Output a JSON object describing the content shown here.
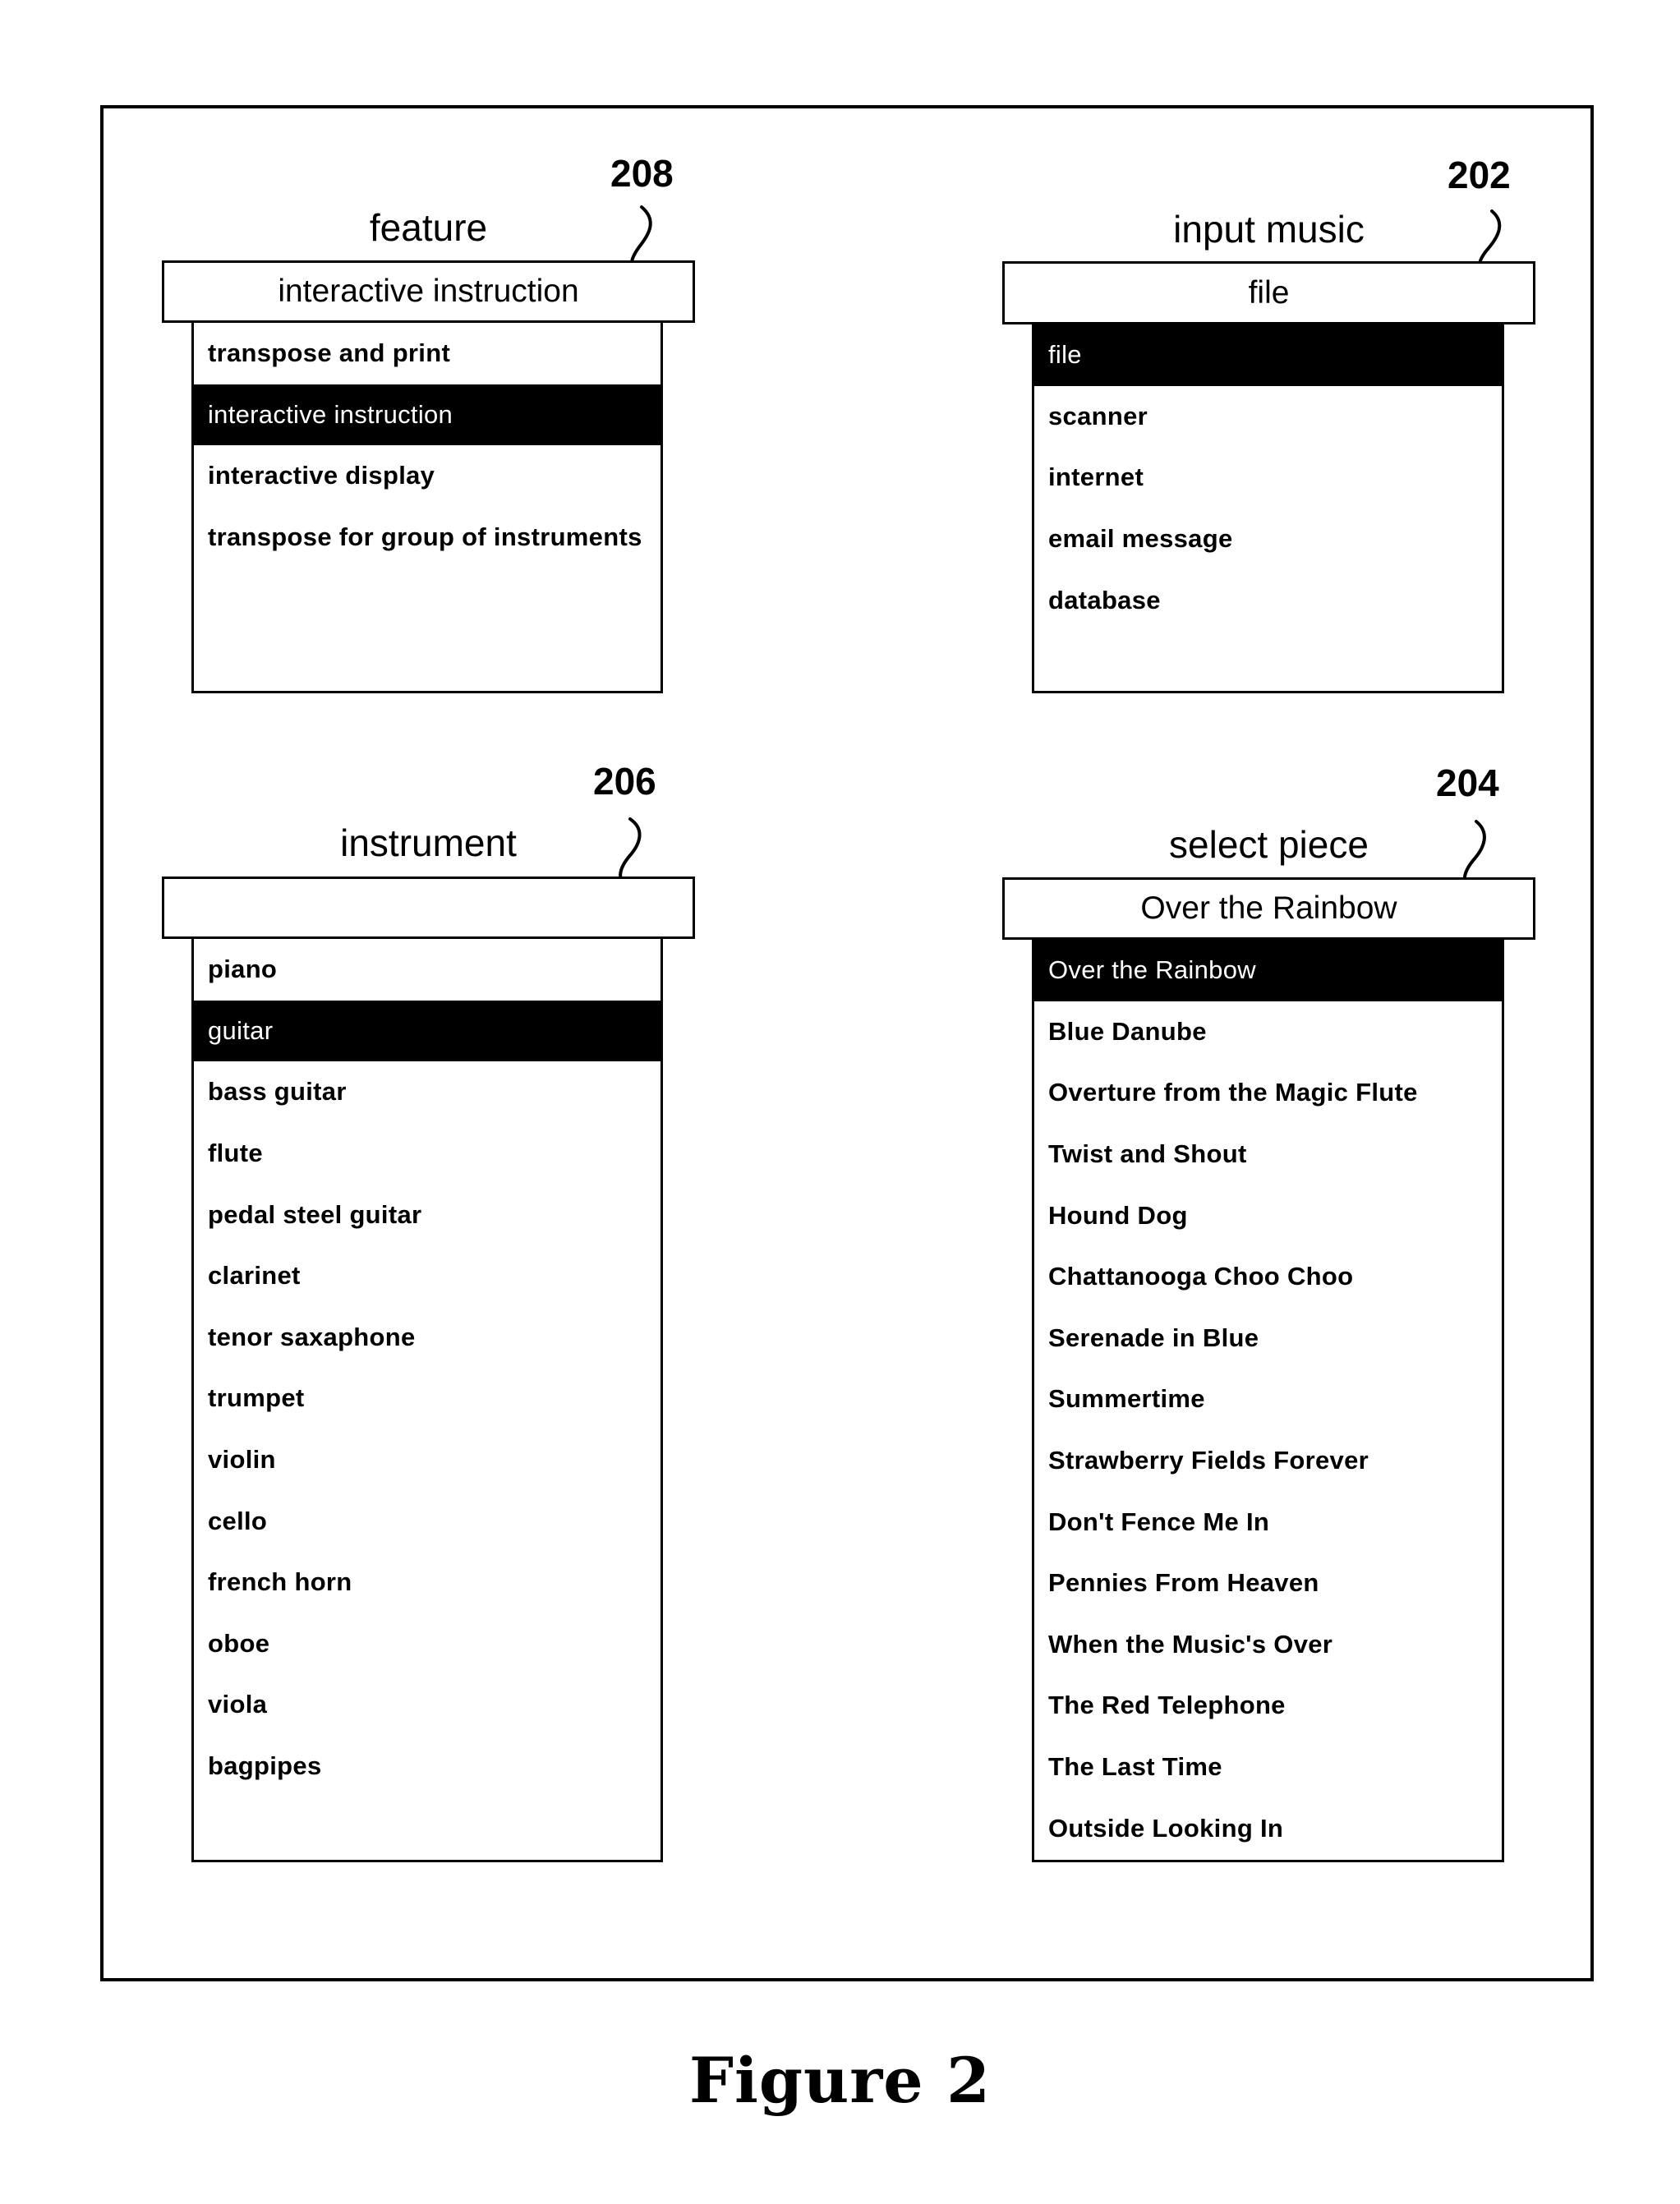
{
  "figure": {
    "caption": "Figure 2"
  },
  "panels": {
    "feature": {
      "ref_number": "208",
      "label": "feature",
      "combo_value": "interactive instruction",
      "items": [
        {
          "label": "transpose and print",
          "selected": false
        },
        {
          "label": "interactive instruction",
          "selected": true
        },
        {
          "label": "interactive display",
          "selected": false
        },
        {
          "label": "transpose for group of instruments",
          "selected": false
        }
      ]
    },
    "input_music": {
      "ref_number": "202",
      "label": "input music",
      "combo_value": "file",
      "items": [
        {
          "label": "file",
          "selected": true
        },
        {
          "label": "scanner",
          "selected": false
        },
        {
          "label": "internet",
          "selected": false
        },
        {
          "label": "email message",
          "selected": false
        },
        {
          "label": "database",
          "selected": false
        }
      ]
    },
    "instrument": {
      "ref_number": "206",
      "label": "instrument",
      "combo_value": "",
      "items": [
        {
          "label": "piano",
          "selected": false
        },
        {
          "label": "guitar",
          "selected": true
        },
        {
          "label": "bass guitar",
          "selected": false
        },
        {
          "label": "flute",
          "selected": false
        },
        {
          "label": "pedal steel guitar",
          "selected": false
        },
        {
          "label": "clarinet",
          "selected": false
        },
        {
          "label": "tenor saxaphone",
          "selected": false
        },
        {
          "label": "trumpet",
          "selected": false
        },
        {
          "label": "violin",
          "selected": false
        },
        {
          "label": "cello",
          "selected": false
        },
        {
          "label": "french horn",
          "selected": false
        },
        {
          "label": "oboe",
          "selected": false
        },
        {
          "label": "viola",
          "selected": false
        },
        {
          "label": "bagpipes",
          "selected": false
        }
      ]
    },
    "select_piece": {
      "ref_number": "204",
      "label": "select piece",
      "combo_value": "Over the Rainbow",
      "items": [
        {
          "label": "Over the Rainbow",
          "selected": true
        },
        {
          "label": "Blue Danube",
          "selected": false
        },
        {
          "label": "Overture from the Magic Flute",
          "selected": false
        },
        {
          "label": "Twist and Shout",
          "selected": false
        },
        {
          "label": "Hound Dog",
          "selected": false
        },
        {
          "label": "Chattanooga Choo Choo",
          "selected": false
        },
        {
          "label": "Serenade in Blue",
          "selected": false
        },
        {
          "label": "Summertime",
          "selected": false
        },
        {
          "label": "Strawberry Fields Forever",
          "selected": false
        },
        {
          "label": "Don't Fence Me In",
          "selected": false
        },
        {
          "label": "Pennies From Heaven",
          "selected": false
        },
        {
          "label": "When the Music's Over",
          "selected": false
        },
        {
          "label": "The Red Telephone",
          "selected": false
        },
        {
          "label": "The Last Time",
          "selected": false
        },
        {
          "label": "Outside Looking In",
          "selected": false
        }
      ]
    }
  }
}
